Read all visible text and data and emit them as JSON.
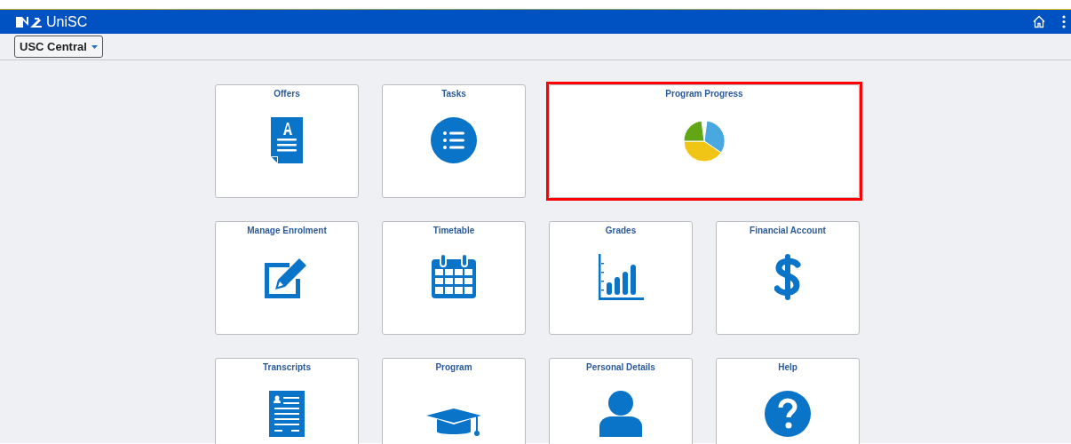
{
  "header": {
    "logo_text": "UniSC"
  },
  "nav": {
    "dropdown": "USC Central"
  },
  "tile_rows": [
    [
      {
        "title": "Offers",
        "kind": "tile",
        "highlighted": false
      },
      {
        "title": "Tasks",
        "kind": "tile",
        "highlighted": false
      },
      {
        "title": "Program Progress",
        "kind": "chart",
        "highlighted": true
      }
    ],
    [
      {
        "title": "Manage Enrolment",
        "kind": "tile",
        "highlighted": false
      },
      {
        "title": "Timetable",
        "kind": "tile",
        "highlighted": false
      },
      {
        "title": "Grades",
        "kind": "tile",
        "highlighted": false
      },
      {
        "title": "Financial Account",
        "kind": "tile",
        "highlighted": false
      }
    ],
    [
      {
        "title": "Transcripts",
        "kind": "tile",
        "highlighted": false
      },
      {
        "title": "Program",
        "kind": "tile",
        "highlighted": false
      },
      {
        "title": "Personal Details",
        "kind": "tile",
        "highlighted": false
      },
      {
        "title": "Help",
        "kind": "tile",
        "highlighted": false
      }
    ]
  ]
}
